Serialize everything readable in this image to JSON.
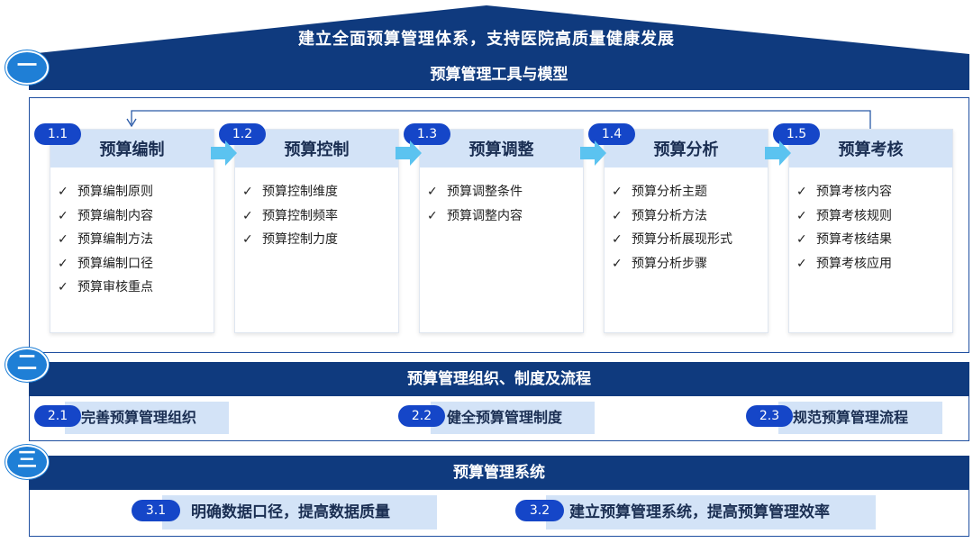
{
  "header": {
    "title": "建立全面预算管理体系，支持医院高质量健康发展"
  },
  "section1": {
    "numeral": "一",
    "title": "预算管理工具与模型",
    "check": "✓",
    "cards": [
      {
        "badge": "1.1",
        "title": "预算编制",
        "items": [
          "预算编制原则",
          "预算编制内容",
          "预算编制方法",
          "预算编制口径",
          "预算审核重点"
        ]
      },
      {
        "badge": "1.2",
        "title": "预算控制",
        "items": [
          "预算控制维度",
          "预算控制频率",
          "预算控制力度"
        ]
      },
      {
        "badge": "1.3",
        "title": "预算调整",
        "items": [
          "预算调整条件",
          "预算调整内容"
        ]
      },
      {
        "badge": "1.4",
        "title": "预算分析",
        "items": [
          "预算分析主题",
          "预算分析方法",
          "预算分析展现形式",
          "预算分析步骤"
        ]
      },
      {
        "badge": "1.5",
        "title": "预算考核",
        "items": [
          "预算考核内容",
          "预算考核规则",
          "预算考核结果",
          "预算考核应用"
        ]
      }
    ]
  },
  "section2": {
    "numeral": "二",
    "title": "预算管理组织、制度及流程",
    "boxes": [
      {
        "badge": "2.1",
        "label": "完善预算管理组织"
      },
      {
        "badge": "2.2",
        "label": "健全预算管理制度"
      },
      {
        "badge": "2.3",
        "label": "规范预算管理流程"
      }
    ]
  },
  "section3": {
    "numeral": "三",
    "title": "预算管理系统",
    "boxes": [
      {
        "badge": "3.1",
        "label": "明确数据口径，提高数据质量"
      },
      {
        "badge": "3.2",
        "label": "建立预算管理系统，提高预算管理效率"
      }
    ]
  },
  "colors": {
    "navy": "#0f3a7e",
    "accent": "#1f7fd6",
    "badge": "#1546c8",
    "light": "#d3e3f7",
    "arrow": "#5bc3f0"
  }
}
